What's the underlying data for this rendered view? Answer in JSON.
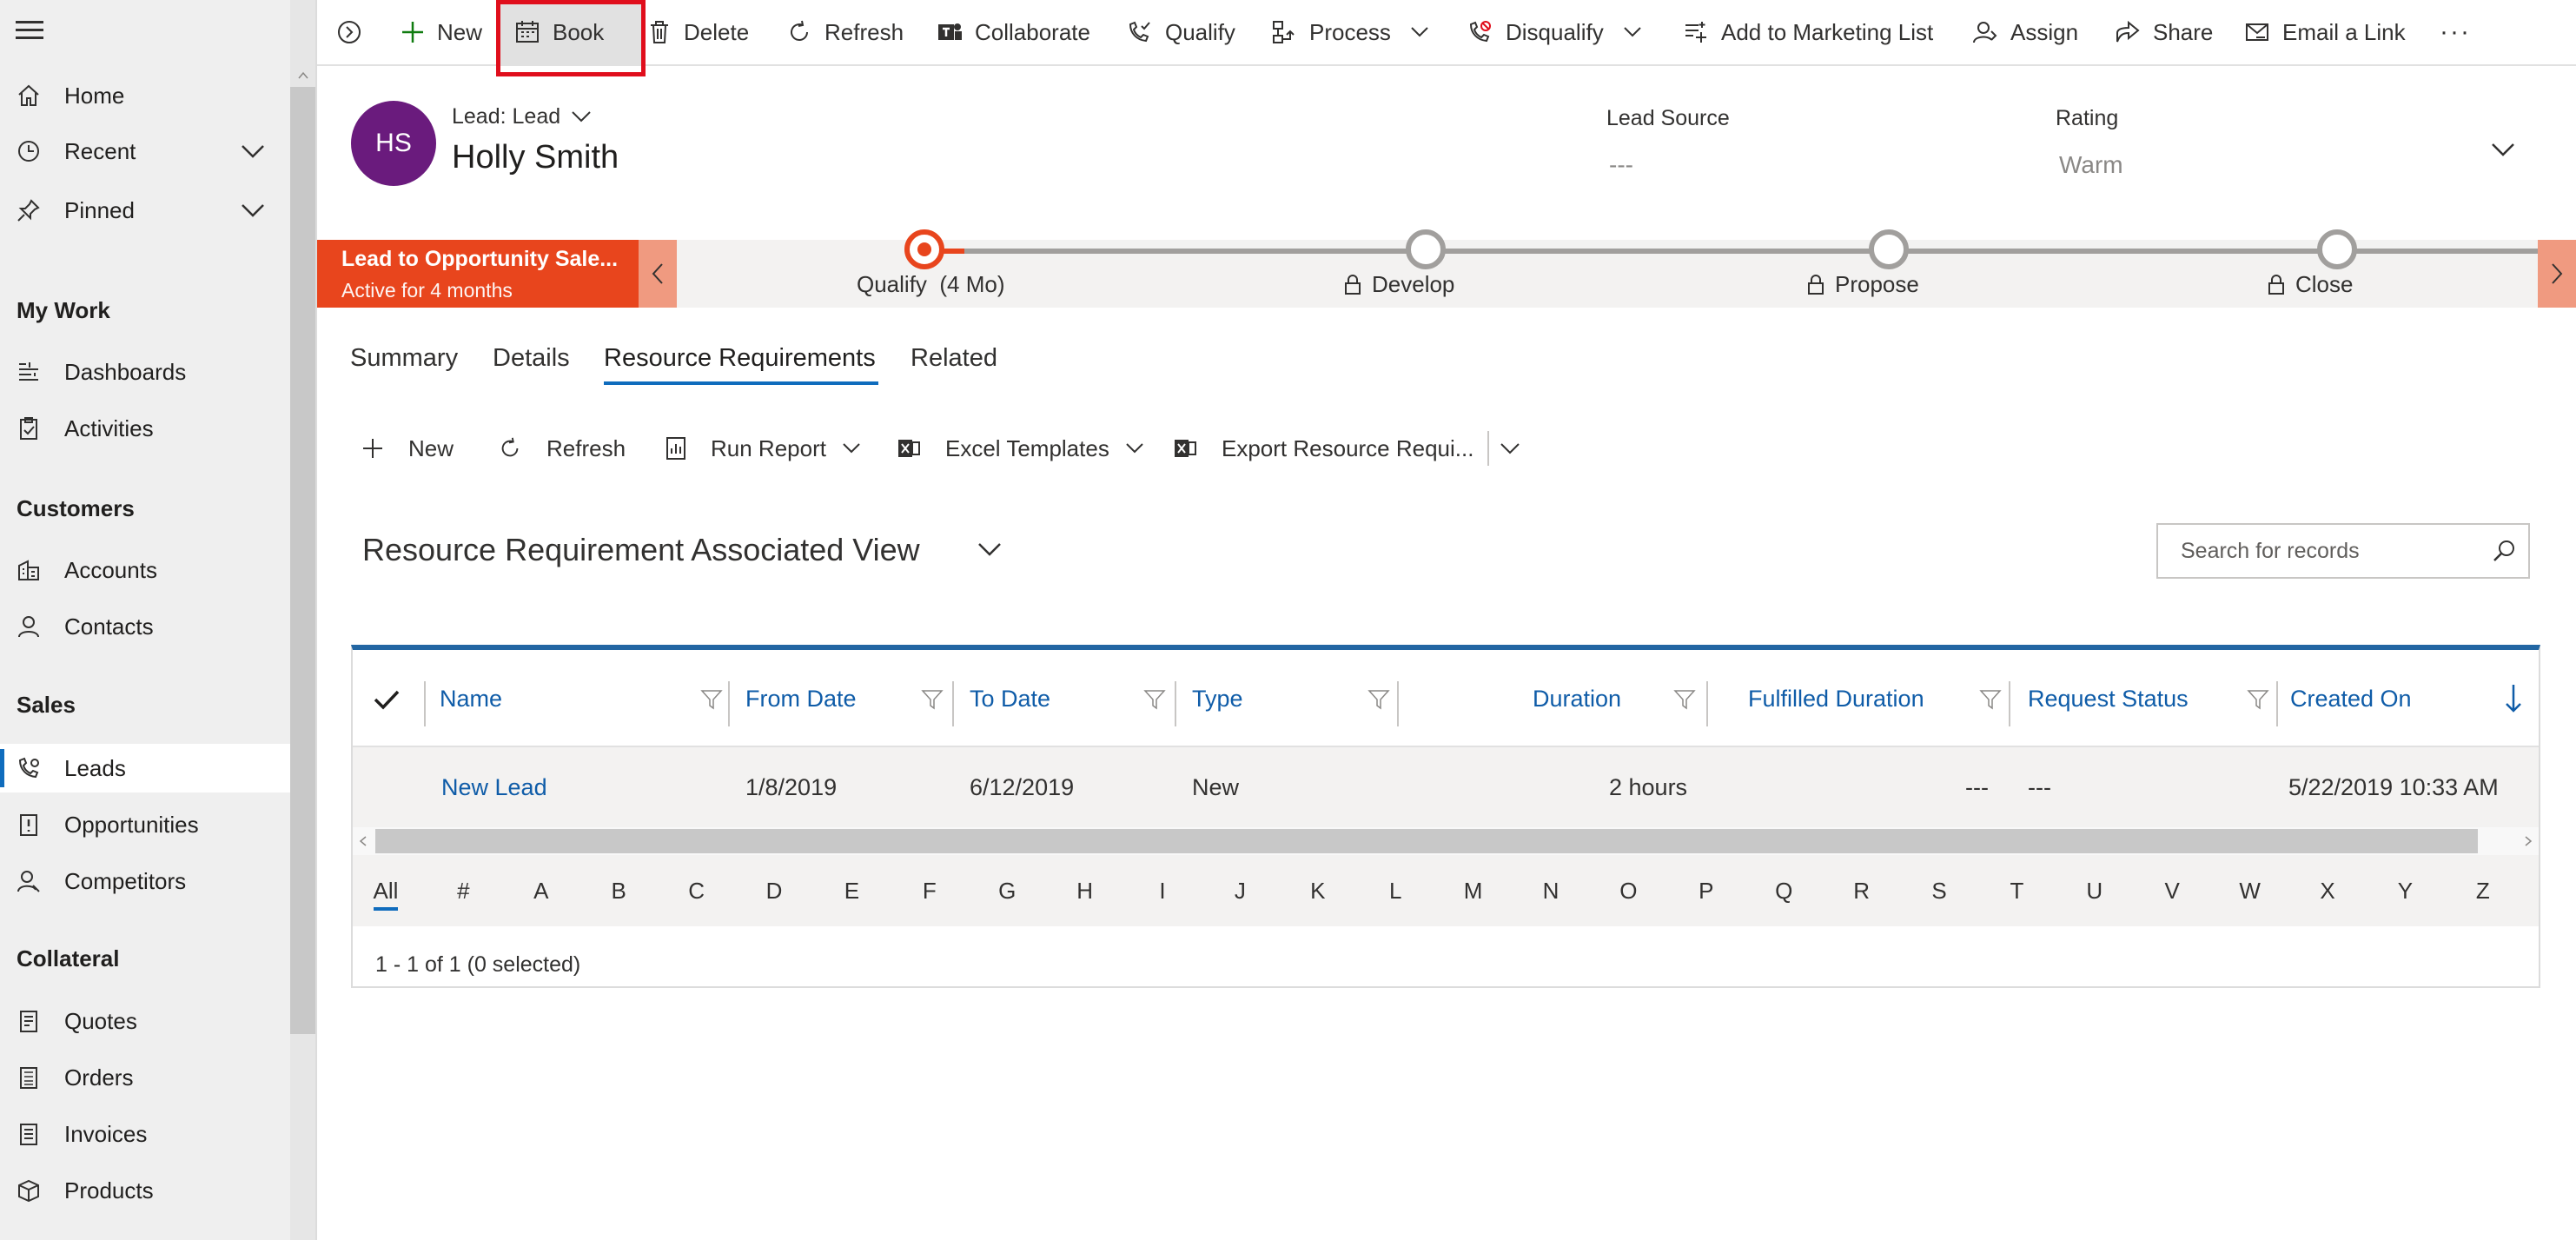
{
  "sidebar": {
    "items": [
      {
        "label": "Home",
        "icon": "home-icon"
      },
      {
        "label": "Recent",
        "icon": "clock-icon"
      },
      {
        "label": "Pinned",
        "icon": "pin-icon"
      }
    ],
    "groups": [
      {
        "heading": "My Work",
        "items": [
          {
            "label": "Dashboards"
          },
          {
            "label": "Activities"
          }
        ]
      },
      {
        "heading": "Customers",
        "items": [
          {
            "label": "Accounts"
          },
          {
            "label": "Contacts"
          }
        ]
      },
      {
        "heading": "Sales",
        "items": [
          {
            "label": "Leads",
            "active": true
          },
          {
            "label": "Opportunities"
          },
          {
            "label": "Competitors"
          }
        ]
      },
      {
        "heading": "Collateral",
        "items": [
          {
            "label": "Quotes"
          },
          {
            "label": "Orders"
          },
          {
            "label": "Invoices"
          },
          {
            "label": "Products"
          }
        ]
      }
    ]
  },
  "toolbar": {
    "new": "New",
    "book": "Book",
    "delete": "Delete",
    "refresh": "Refresh",
    "collaborate": "Collaborate",
    "qualify": "Qualify",
    "process": "Process",
    "disqualify": "Disqualify",
    "add_to_marketing_list": "Add to Marketing List",
    "assign": "Assign",
    "share": "Share",
    "email_a_link": "Email a Link",
    "more": "···"
  },
  "header": {
    "avatar_initials": "HS",
    "entity_type": "Lead: Lead",
    "record_name": "Holly Smith",
    "lead_source_label": "Lead Source",
    "lead_source_value": "---",
    "rating_label": "Rating",
    "rating_value": "Warm"
  },
  "process": {
    "name": "Lead to Opportunity Sale...",
    "status": "Active for 4 months",
    "stages": [
      {
        "label": "Qualify",
        "duration": "(4 Mo)",
        "active": true
      },
      {
        "label": "Develop",
        "locked": true
      },
      {
        "label": "Propose",
        "locked": true
      },
      {
        "label": "Close",
        "locked": true
      }
    ]
  },
  "tabs": [
    "Summary",
    "Details",
    "Resource Requirements",
    "Related"
  ],
  "active_tab": "Resource Requirements",
  "subgrid_toolbar": {
    "new": "New",
    "refresh": "Refresh",
    "run_report": "Run Report",
    "excel_templates": "Excel Templates",
    "export": "Export Resource Requi..."
  },
  "view": {
    "title": "Resource Requirement Associated View",
    "search_placeholder": "Search for records"
  },
  "grid": {
    "columns": [
      "Name",
      "From Date",
      "To Date",
      "Type",
      "Duration",
      "Fulfilled Duration",
      "Request Status",
      "Created On"
    ],
    "rows": [
      {
        "name": "New Lead",
        "from_date": "1/8/2019",
        "to_date": "6/12/2019",
        "type": "New",
        "duration": "2 hours",
        "fulfilled_duration": "---",
        "request_status": "---",
        "created_on": "5/22/2019 10:33 AM"
      }
    ],
    "alphabet": [
      "All",
      "#",
      "A",
      "B",
      "C",
      "D",
      "E",
      "F",
      "G",
      "H",
      "I",
      "J",
      "K",
      "L",
      "M",
      "N",
      "O",
      "P",
      "Q",
      "R",
      "S",
      "T",
      "U",
      "V",
      "W",
      "X",
      "Y",
      "Z"
    ],
    "footer": "1 - 1 of 1 (0 selected)"
  },
  "colors": {
    "accent": "#0f6cbd",
    "process_active": "#e8451d",
    "avatar": "#6a1b7d",
    "highlight": "#e00e1c"
  }
}
